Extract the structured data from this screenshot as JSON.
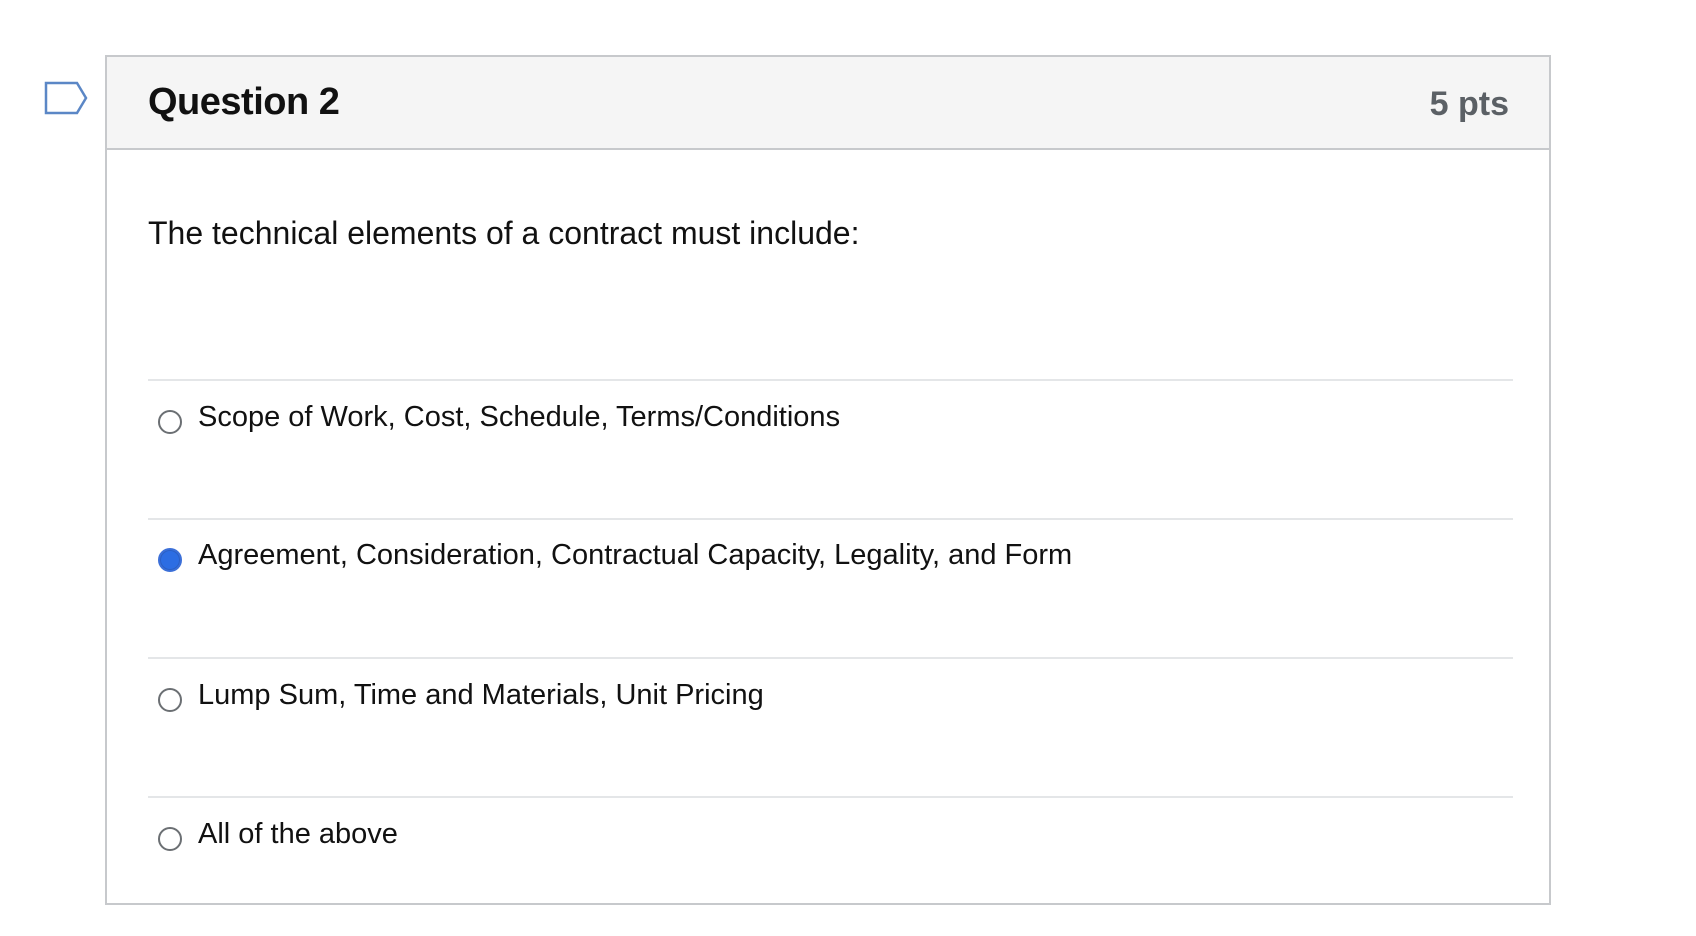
{
  "question": {
    "title": "Question 2",
    "points": "5 pts",
    "text": "The technical elements of a contract must include:",
    "flag_icon": "flag-icon"
  },
  "answers": [
    {
      "label": "Scope of Work, Cost, Schedule, Terms/Conditions",
      "selected": false
    },
    {
      "label": "Agreement, Consideration, Contractual Capacity, Legality, and Form",
      "selected": true
    },
    {
      "label": "Lump Sum, Time and Materials, Unit Pricing",
      "selected": false
    },
    {
      "label": "All of the above",
      "selected": false
    }
  ],
  "colors": {
    "selected_radio": "#2c6de3",
    "header_background": "#f5f5f5",
    "border": "#c7c9cc",
    "flag_outline": "#5b87c6"
  }
}
